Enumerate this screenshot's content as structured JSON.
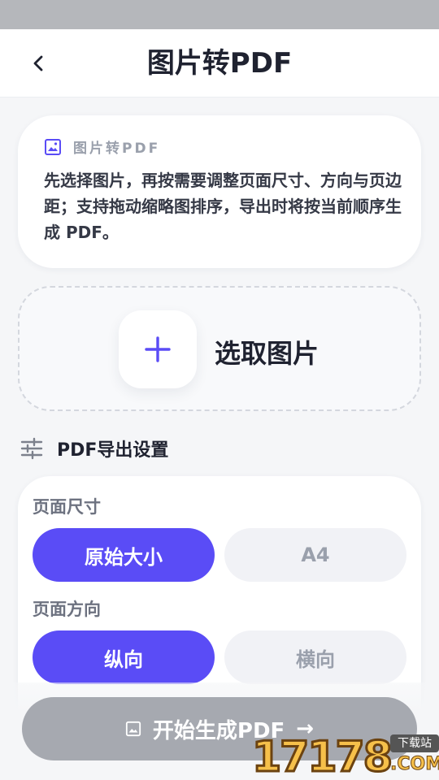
{
  "header": {
    "title": "图片转PDF",
    "back_icon": "chevron-left-icon"
  },
  "info_card": {
    "icon": "image-icon",
    "label": "图片转PDF",
    "text": "先选择图片，再按需要调整页面尺寸、方向与页边距；支持拖动缩略图排序，导出时将按当前顺序生成 PDF。"
  },
  "picker": {
    "icon": "plus-icon",
    "label": "选取图片"
  },
  "settings": {
    "icon": "sliders-icon",
    "title": "PDF导出设置",
    "page_size": {
      "label": "页面尺寸",
      "options": [
        "原始大小",
        "A4"
      ],
      "selected": "原始大小"
    },
    "orientation": {
      "label": "页面方向",
      "options": [
        "纵向",
        "横向"
      ],
      "selected": "纵向"
    }
  },
  "start_button": {
    "label": "开始生成PDF",
    "icon": "image-icon",
    "arrow": "→"
  },
  "watermark": {
    "number": "17178",
    "badge": "下载站",
    "suffix": ".COM"
  },
  "colors": {
    "accent": "#5a4cf6",
    "disabled_button": "#a6a9b0",
    "background": "#f5f6f8"
  }
}
